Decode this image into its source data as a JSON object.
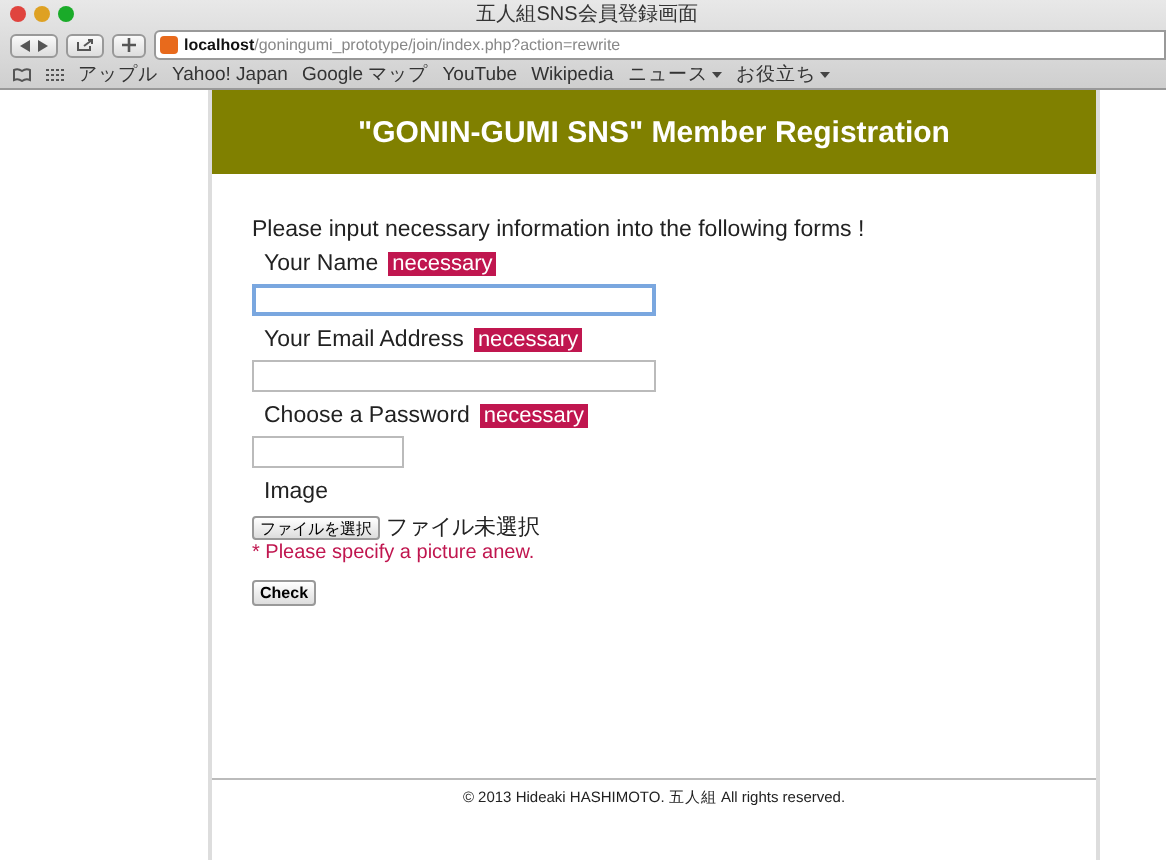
{
  "window": {
    "title": "五人組SNS会員登録画面"
  },
  "address_bar": {
    "url": "**localhost**/goningumi_prototype/join/index.php?action=rewrite"
  },
  "bookmarks": [
    {
      "label": "アップル",
      "menu": false
    },
    {
      "label": "Yahoo! Japan",
      "menu": false
    },
    {
      "label": "Google マップ",
      "menu": false
    },
    {
      "label": "YouTube",
      "menu": false
    },
    {
      "label": "Wikipedia",
      "menu": false
    },
    {
      "label": "ニュース",
      "menu": true
    },
    {
      "label": "お役立ち",
      "menu": true
    }
  ],
  "page": {
    "header": "\"GONIN-GUMI SNS\" Member Registration",
    "intro": "Please input necessary information into the following forms !",
    "fields": [
      {
        "kind": "text",
        "label": "Your Name",
        "badge": "necessary",
        "focused": true
      },
      {
        "kind": "text",
        "label": "Your Email Address",
        "badge": "necessary",
        "focused": false
      },
      {
        "kind": "password",
        "label": "Choose a Password",
        "badge": "necessary",
        "focused": false
      },
      {
        "kind": "file",
        "label": "Image",
        "button": "ファイルを選択",
        "status": "ファイル未選択",
        "error": "* Please specify a picture anew."
      }
    ],
    "submit": "Check",
    "footer": "© 2013 Hideaki HASHIMOTO. 五人組 All rights reserved."
  }
}
